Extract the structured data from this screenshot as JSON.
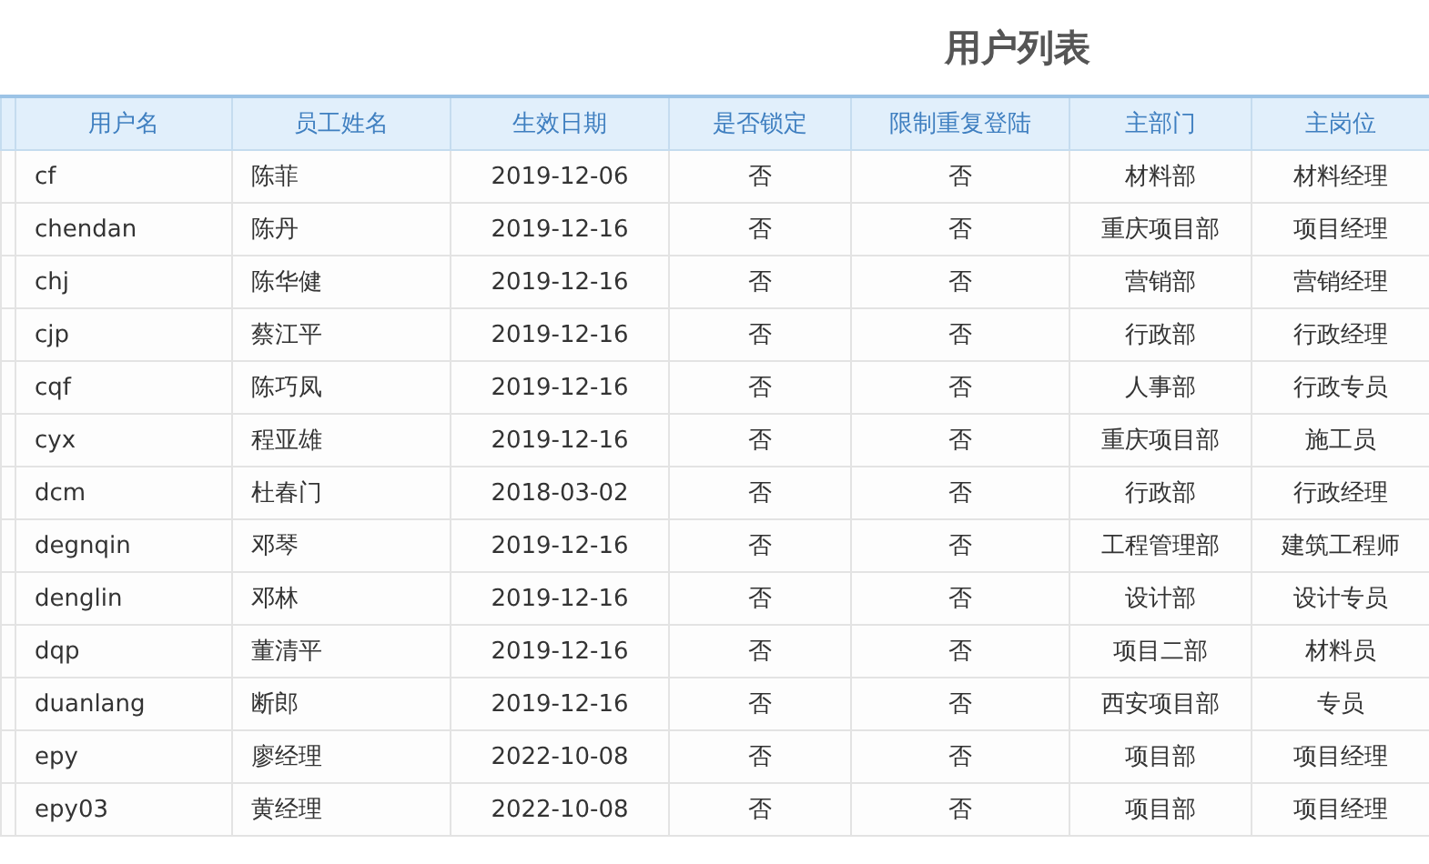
{
  "title": "用户列表",
  "table": {
    "columns": [
      "用户名",
      "员工姓名",
      "生效日期",
      "是否锁定",
      "限制重复登陆",
      "主部门",
      "主岗位"
    ],
    "rows": [
      [
        "cf",
        "陈菲",
        "2019-12-06",
        "否",
        "否",
        "材料部",
        "材料经理"
      ],
      [
        "chendan",
        "陈丹",
        "2019-12-16",
        "否",
        "否",
        "重庆项目部",
        "项目经理"
      ],
      [
        "chj",
        "陈华健",
        "2019-12-16",
        "否",
        "否",
        "营销部",
        "营销经理"
      ],
      [
        "cjp",
        "蔡江平",
        "2019-12-16",
        "否",
        "否",
        "行政部",
        "行政经理"
      ],
      [
        "cqf",
        "陈巧凤",
        "2019-12-16",
        "否",
        "否",
        "人事部",
        "行政专员"
      ],
      [
        "cyx",
        "程亚雄",
        "2019-12-16",
        "否",
        "否",
        "重庆项目部",
        "施工员"
      ],
      [
        "dcm",
        "杜春门",
        "2018-03-02",
        "否",
        "否",
        "行政部",
        "行政经理"
      ],
      [
        "degnqin",
        "邓琴",
        "2019-12-16",
        "否",
        "否",
        "工程管理部",
        "建筑工程师"
      ],
      [
        "denglin",
        "邓林",
        "2019-12-16",
        "否",
        "否",
        "设计部",
        "设计专员"
      ],
      [
        "dqp",
        "董清平",
        "2019-12-16",
        "否",
        "否",
        "项目二部",
        "材料员"
      ],
      [
        "duanlang",
        "断郎",
        "2019-12-16",
        "否",
        "否",
        "西安项目部",
        "专员"
      ],
      [
        "epy",
        "廖经理",
        "2022-10-08",
        "否",
        "否",
        "项目部",
        "项目经理"
      ],
      [
        "epy03",
        "黄经理",
        "2022-10-08",
        "否",
        "否",
        "项目部",
        "项目经理"
      ]
    ]
  }
}
